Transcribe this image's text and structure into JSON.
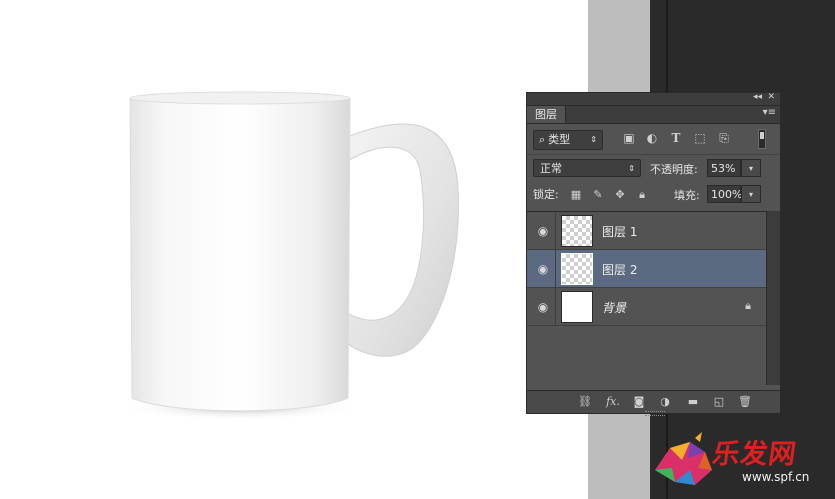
{
  "panel": {
    "tab_label": "图层",
    "collapse_glyph": "◂◂",
    "close_glyph": "✕",
    "menu_glyph": "▾≡",
    "filter": {
      "kind_label": "类型"
    },
    "blend_mode": "正常",
    "opacity_label": "不透明度:",
    "opacity_value": "53%",
    "lock_label": "锁定:",
    "fill_label": "填充:",
    "fill_value": "100%",
    "layers": [
      {
        "name": "图层 1",
        "thumbnail": "transparent-checker",
        "visible": true,
        "selected": false
      },
      {
        "name": "图层 2",
        "thumbnail": "transparent-checker",
        "visible": true,
        "selected": true
      },
      {
        "name": "背景",
        "thumbnail": "white",
        "visible": true,
        "selected": false,
        "locked": true
      }
    ],
    "bottom_icons": [
      "link-icon",
      "fx-icon",
      "mask-icon",
      "adjustment-icon",
      "folder-icon",
      "new-layer-icon",
      "trash-icon"
    ],
    "fx_text": "fx."
  },
  "watermark": {
    "text": "乐发网",
    "url": "www.spf.cn"
  },
  "colors": {
    "panel_bg": "#535353",
    "selected_layer": "#5b6a80",
    "watermark_red": "#e02020"
  }
}
